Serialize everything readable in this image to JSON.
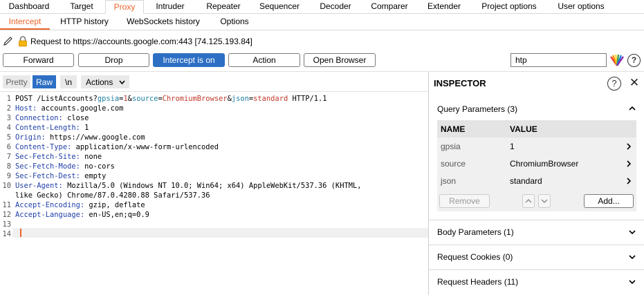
{
  "top_tabs": [
    "Dashboard",
    "Target",
    "Proxy",
    "Intruder",
    "Repeater",
    "Sequencer",
    "Decoder",
    "Comparer",
    "Extender",
    "Project options",
    "User options"
  ],
  "sub_tabs": [
    "Intercept",
    "HTTP history",
    "WebSockets history",
    "Options"
  ],
  "request_info": "Request to https://accounts.google.com:443  [74.125.193.84]",
  "buttons": {
    "forward": "Forward",
    "drop": "Drop",
    "intercept": "Intercept is on",
    "action": "Action",
    "open_browser": "Open Browser"
  },
  "filter_value": "htp",
  "help_symbol": "?",
  "editor_toolbar": {
    "pretty": "Pretty",
    "raw": "Raw",
    "newline": "\\n",
    "actions": "Actions"
  },
  "request_lines": [
    {
      "n": "1",
      "parts": [
        [
          "",
          "POST /ListAccounts?"
        ],
        [
          "pk",
          "gpsia"
        ],
        [
          "",
          "="
        ],
        [
          "pv",
          "1"
        ],
        [
          "",
          "&"
        ],
        [
          "pk",
          "source"
        ],
        [
          "",
          "="
        ],
        [
          "pv",
          "ChromiumBrowser"
        ],
        [
          "",
          "&"
        ],
        [
          "pk",
          "json"
        ],
        [
          "",
          "="
        ],
        [
          "pv",
          "standard"
        ],
        [
          "",
          " HTTP/1.1"
        ]
      ]
    },
    {
      "n": "2",
      "parts": [
        [
          "hk",
          "Host:"
        ],
        [
          "",
          " accounts.google.com"
        ]
      ]
    },
    {
      "n": "3",
      "parts": [
        [
          "hk",
          "Connection:"
        ],
        [
          "",
          " close"
        ]
      ]
    },
    {
      "n": "4",
      "parts": [
        [
          "hk",
          "Content-Length:"
        ],
        [
          "",
          " 1"
        ]
      ]
    },
    {
      "n": "5",
      "parts": [
        [
          "hk",
          "Origin:"
        ],
        [
          "",
          " https://www.google.com"
        ]
      ]
    },
    {
      "n": "6",
      "parts": [
        [
          "hk",
          "Content-Type:"
        ],
        [
          "",
          " application/x-www-form-urlencoded"
        ]
      ]
    },
    {
      "n": "7",
      "parts": [
        [
          "hk",
          "Sec-Fetch-Site:"
        ],
        [
          "",
          " none"
        ]
      ]
    },
    {
      "n": "8",
      "parts": [
        [
          "hk",
          "Sec-Fetch-Mode:"
        ],
        [
          "",
          " no-cors"
        ]
      ]
    },
    {
      "n": "9",
      "parts": [
        [
          "hk",
          "Sec-Fetch-Dest:"
        ],
        [
          "",
          " empty"
        ]
      ]
    },
    {
      "n": "10",
      "parts": [
        [
          "hk",
          "User-Agent:"
        ],
        [
          "",
          " Mozilla/5.0 (Windows NT 10.0; Win64; x64) AppleWebKit/537.36 (KHTML,"
        ]
      ]
    },
    {
      "n": "",
      "parts": [
        [
          "",
          "like Gecko) Chrome/87.0.4280.88 Safari/537.36"
        ]
      ]
    },
    {
      "n": "11",
      "parts": [
        [
          "hk",
          "Accept-Encoding:"
        ],
        [
          "",
          " gzip, deflate"
        ]
      ]
    },
    {
      "n": "12",
      "parts": [
        [
          "hk",
          "Accept-Language:"
        ],
        [
          "",
          " en-US,en;q=0.9"
        ]
      ]
    },
    {
      "n": "13",
      "parts": []
    },
    {
      "n": "14",
      "parts": []
    }
  ],
  "inspector": {
    "title": "INSPECTOR",
    "close": "✕",
    "query_title": "Query Parameters (3)",
    "col_name": "NAME",
    "col_value": "VALUE",
    "params": [
      {
        "name": "gpsia",
        "value": "1"
      },
      {
        "name": "source",
        "value": "ChromiumBrowser"
      },
      {
        "name": "json",
        "value": "standard"
      }
    ],
    "remove": "Remove",
    "add": "Add...",
    "sections": [
      "Body Parameters (1)",
      "Request Cookies (0)",
      "Request Headers (11)"
    ]
  },
  "colors": {
    "accent": "#e8652a",
    "button_blue": "#2d6fc4",
    "header_key": "#1f3fa8",
    "param_key": "#1f7fa0",
    "param_value": "#c0392b"
  }
}
